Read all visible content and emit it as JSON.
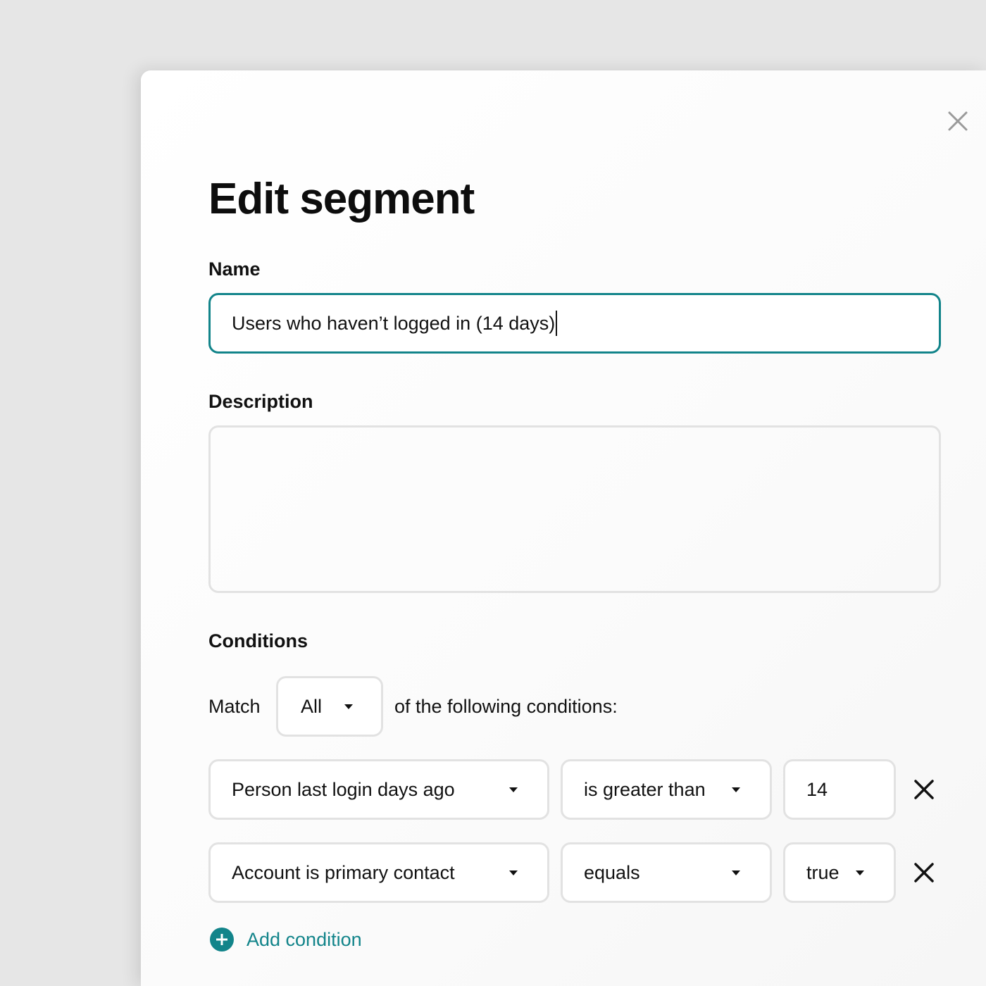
{
  "modal": {
    "title": "Edit segment",
    "close_icon": "close-icon"
  },
  "name_field": {
    "label": "Name",
    "value": "Users who haven’t logged in (14 days)"
  },
  "description_field": {
    "label": "Description",
    "value": ""
  },
  "conditions": {
    "label": "Conditions",
    "match_prefix": "Match",
    "match_value": "All",
    "match_suffix": "of the following conditions:",
    "rows": [
      {
        "property": "Person last login days ago",
        "operator": "is greater than",
        "value": "14"
      },
      {
        "property": "Account is primary contact",
        "operator": "equals",
        "value": "true"
      }
    ],
    "add_label": "Add condition"
  },
  "colors": {
    "accent": "#12848a",
    "border": "#e2e2e2",
    "background": "#e6e6e6"
  }
}
